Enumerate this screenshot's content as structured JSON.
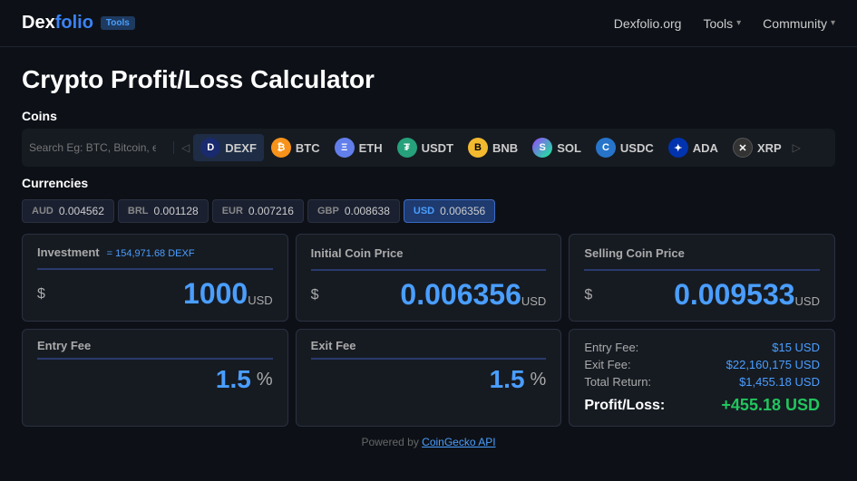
{
  "nav": {
    "logo_main": "Dexfolio",
    "logo_accent": "",
    "tools_badge": "Tools",
    "links": [
      {
        "label": "Dexfolio.org",
        "has_chevron": false
      },
      {
        "label": "Tools",
        "has_chevron": true
      },
      {
        "label": "Community",
        "has_chevron": true
      }
    ]
  },
  "page": {
    "title": "Crypto Profit/Loss Calculator"
  },
  "coins": {
    "section_label": "Coins",
    "search_placeholder": "Search Eg: BTC, Bitcoin, etc.",
    "items": [
      {
        "symbol": "DEXF",
        "icon_text": "D",
        "icon_class": "coin-dexf",
        "active": true
      },
      {
        "symbol": "BTC",
        "icon_text": "₿",
        "icon_class": "coin-btc",
        "active": false
      },
      {
        "symbol": "ETH",
        "icon_text": "Ξ",
        "icon_class": "coin-eth",
        "active": false
      },
      {
        "symbol": "USDT",
        "icon_text": "₮",
        "icon_class": "coin-usdt",
        "active": false
      },
      {
        "symbol": "BNB",
        "icon_text": "B",
        "icon_class": "coin-bnb",
        "active": false
      },
      {
        "symbol": "SOL",
        "icon_text": "S",
        "icon_class": "coin-sol",
        "active": false
      },
      {
        "symbol": "USDC",
        "icon_text": "C",
        "icon_class": "coin-usdc",
        "active": false
      },
      {
        "symbol": "ADA",
        "icon_text": "✦",
        "icon_class": "coin-ada",
        "active": false
      },
      {
        "symbol": "XRP",
        "icon_text": "✕",
        "icon_class": "coin-xrp",
        "active": false
      }
    ]
  },
  "currencies": {
    "section_label": "Currencies",
    "items": [
      {
        "name": "AUD",
        "value": "0.004562",
        "active": false
      },
      {
        "name": "BRL",
        "value": "0.001128",
        "active": false
      },
      {
        "name": "EUR",
        "value": "0.007216",
        "active": false
      },
      {
        "name": "GBP",
        "value": "0.008638",
        "active": false
      },
      {
        "name": "USD",
        "value": "0.006356",
        "active": true
      }
    ]
  },
  "investment": {
    "label": "Investment",
    "equiv": "= 154,971.68 DEXF",
    "dollar_sign": "$",
    "value": "1000",
    "unit": "USD"
  },
  "initial_price": {
    "label": "Initial Coin Price",
    "dollar_sign": "$",
    "value": "0.006356",
    "unit": "USD"
  },
  "selling_price": {
    "label": "Selling Coin Price",
    "dollar_sign": "$",
    "value": "0.009533",
    "unit": "USD"
  },
  "entry_fee": {
    "label": "Entry Fee",
    "value": "1.5",
    "unit": "%"
  },
  "exit_fee": {
    "label": "Exit Fee",
    "value": "1.5",
    "unit": "%"
  },
  "results": {
    "entry_fee_label": "Entry Fee:",
    "entry_fee_value": "$15 USD",
    "exit_fee_label": "Exit Fee:",
    "exit_fee_value": "$22,160,175 USD",
    "total_return_label": "Total Return:",
    "total_return_value": "$1,455.18 USD",
    "profit_loss_label": "Profit/Loss:",
    "profit_loss_value": "+455.18 USD"
  },
  "footer": {
    "text": "Powered by ",
    "link": "CoinGecko API"
  }
}
